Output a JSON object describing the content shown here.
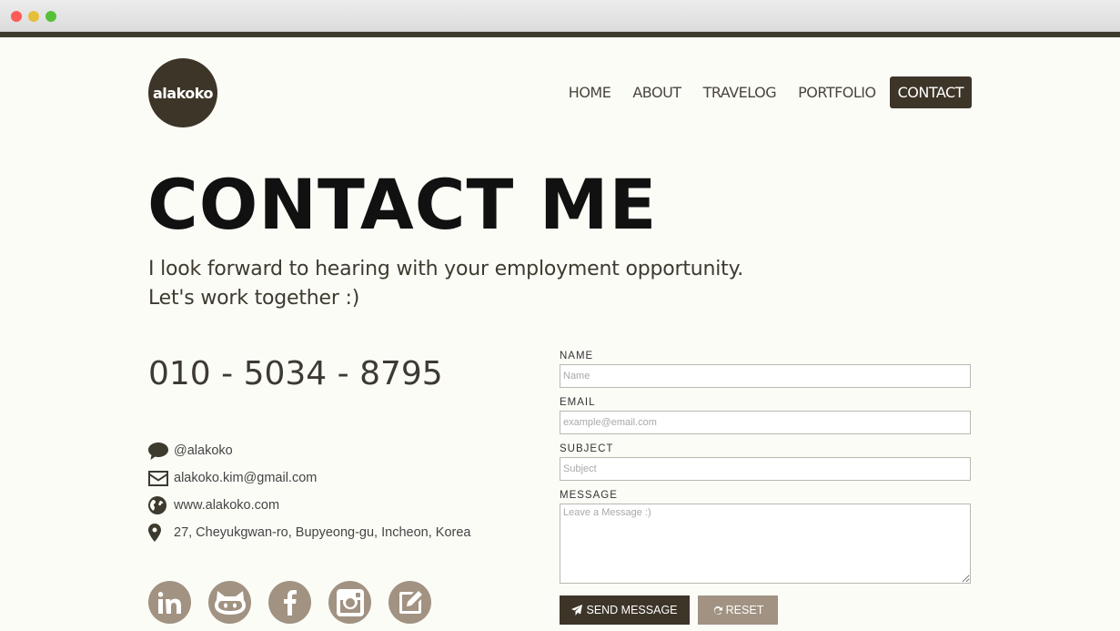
{
  "window": {
    "controls": [
      "close",
      "minimize",
      "maximize"
    ]
  },
  "brand": {
    "logo_text": "alakoko",
    "color": "#3d3528"
  },
  "nav": {
    "items": [
      {
        "label": "HOME"
      },
      {
        "label": "ABOUT"
      },
      {
        "label": "TRAVELOG"
      },
      {
        "label": "PORTFOLIO"
      },
      {
        "label": "CONTACT",
        "active": true
      }
    ]
  },
  "hero": {
    "title": "CONTACT ME",
    "line1": "I look forward to hearing with your employment opportunity.",
    "line2": "Let's work together :)"
  },
  "contact": {
    "phone": "010 - 5034 - 8795",
    "chat": {
      "icon": "chat-bubble-icon",
      "text": "@alakoko"
    },
    "email": {
      "icon": "envelope-icon",
      "text": "alakoko.kim@gmail.com"
    },
    "website": {
      "icon": "globe-icon",
      "text": "www.alakoko.com"
    },
    "address": {
      "icon": "map-pin-icon",
      "text": "27, Cheyukgwan-ro, Bupyeong-gu, Incheon, Korea"
    }
  },
  "social": [
    "linkedin-icon",
    "github-icon",
    "facebook-icon",
    "instagram-icon",
    "blog-edit-icon"
  ],
  "form": {
    "name_label": "NAME",
    "name_placeholder": "Name",
    "email_label": "EMAIL",
    "email_placeholder": "example@email.com",
    "subject_label": "SUBJECT",
    "subject_placeholder": "Subject",
    "message_label": "MESSAGE",
    "message_placeholder": "Leave a Message :)",
    "send_label": "SEND MESSAGE",
    "reset_label": "RESET"
  },
  "colors": {
    "accent": "#3d3528",
    "muted": "#a19282",
    "background": "#fcfcf7"
  }
}
